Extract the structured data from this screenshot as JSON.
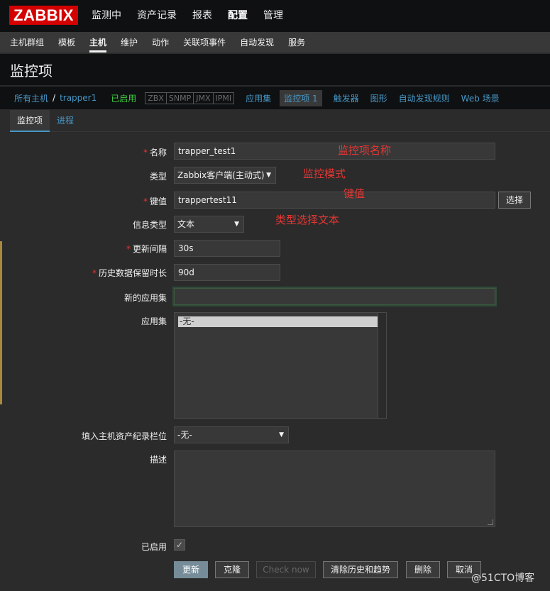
{
  "logo": "ZABBIX",
  "top_menu": [
    "监测中",
    "资产记录",
    "报表",
    "配置",
    "管理"
  ],
  "top_menu_active": 3,
  "sub_menu": [
    "主机群组",
    "模板",
    "主机",
    "维护",
    "动作",
    "关联项事件",
    "自动发现",
    "服务"
  ],
  "sub_menu_active": 2,
  "page_title": "监控项",
  "breadcrumb": {
    "all_hosts": "所有主机",
    "separator": "/",
    "host": "trapper1",
    "status": "已启用",
    "badges": [
      "ZBX",
      "SNMP",
      "JMX",
      "IPMI"
    ],
    "nav": [
      "应用集",
      "监控项 1",
      "触发器",
      "图形",
      "自动发现规则",
      "Web 场景"
    ]
  },
  "tabs": [
    "监控项",
    "进程"
  ],
  "form": {
    "name_label": "名称",
    "name_value": "trapper_test1",
    "type_label": "类型",
    "type_value": "Zabbix客户端(主动式)",
    "key_label": "键值",
    "key_value": "trappertest11",
    "key_select_button": "选择",
    "info_type_label": "信息类型",
    "info_type_value": "文本",
    "interval_label": "更新间隔",
    "interval_value": "30s",
    "history_label": "历史数据保留时长",
    "history_value": "90d",
    "new_app_label": "新的应用集",
    "new_app_value": "",
    "apps_label": "应用集",
    "apps_option": "-无-",
    "inventory_label": "填入主机资产纪录栏位",
    "inventory_value": "-无-",
    "description_label": "描述",
    "enabled_label": "已启用",
    "enabled_check": "✓"
  },
  "buttons": {
    "update": "更新",
    "clone": "克隆",
    "check_now": "Check now",
    "clear_history": "清除历史和趋势",
    "delete": "删除",
    "cancel": "取消"
  },
  "annotations": {
    "name": "监控项名称",
    "mode": "监控模式",
    "key": "键值",
    "type_text": "类型选择文本"
  },
  "watermark": "@51CTO博客",
  "colors": {
    "accent": "#4796c4",
    "required": "#e33734",
    "enabled": "#3fcd3f",
    "logo": "#d40000"
  }
}
